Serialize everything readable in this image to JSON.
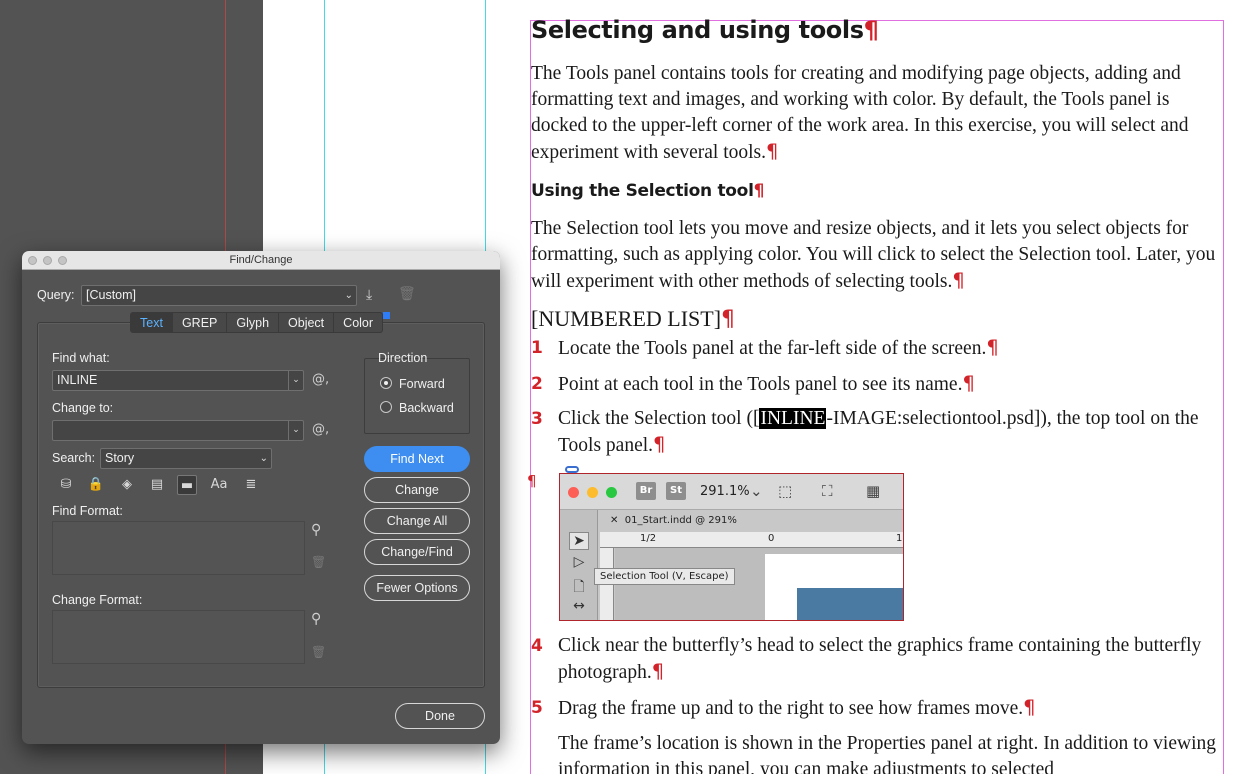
{
  "document": {
    "heading": "Selecting and using tools",
    "intro": "The Tools panel contains tools for creating and modifying page objects, adding and formatting text and images, and working with color. By default, the Tools panel is docked to the upper-left corner of the work area. In this exercise, you will select and experiment with several tools.",
    "subheading": "Using the Selection tool",
    "selection_para": "The Selection tool lets you move and resize objects, and it lets you select objects for formatting, such as applying color. You will click to select the Selection tool. Later, you will experiment with other methods of selecting tools.",
    "list_heading": "[NUMBERED LIST]",
    "pilcrow": "¶",
    "steps": [
      {
        "num": "1",
        "text": "Locate the Tools panel at the far-left side of the screen."
      },
      {
        "num": "2",
        "text": "Point at each tool in the Tools panel to see its name."
      },
      {
        "num": "3",
        "pre": "Click the Selection tool ([",
        "highlight": "INLINE",
        "post": "-IMAGE:selectiontool.psd]), the top tool on the Tools panel."
      },
      {
        "num": "4",
        "text": "Click near the butterfly’s head to select the graphics frame containing the butterfly photograph."
      },
      {
        "num": "5",
        "text": "Drag the frame up and to the right to see how frames move."
      }
    ],
    "after_para": "The frame’s location is shown in the Properties panel at right. In addition to viewing information in this panel, you can make adjustments to selected",
    "inline_image": {
      "br_label": "Br",
      "st_label": "St",
      "zoom": "291.1%",
      "tab": "01_Start.indd @ 291%",
      "ruler_a": "1/2",
      "ruler_b": "0",
      "ruler_c": "1",
      "tooltip": "Selection Tool (V, Escape)"
    }
  },
  "dialog": {
    "title": "Find/Change",
    "query_label": "Query:",
    "query_value": "[Custom]",
    "tabs": [
      "Text",
      "GREP",
      "Glyph",
      "Object",
      "Color"
    ],
    "active_tab": "Text",
    "find_what_label": "Find what:",
    "find_what_value": "INLINE",
    "change_to_label": "Change to:",
    "change_to_value": "",
    "search_label": "Search:",
    "search_value": "Story",
    "direction_label": "Direction",
    "forward_label": "Forward",
    "backward_label": "Backward",
    "direction_selected": "Forward",
    "find_format_label": "Find Format:",
    "change_format_label": "Change Format:",
    "buttons": {
      "find_next": "Find Next",
      "change": "Change",
      "change_all": "Change All",
      "change_find": "Change/Find",
      "fewer_options": "Fewer Options",
      "done": "Done"
    },
    "at_symbol": "@",
    "case_label": "Aa",
    "accent_color": "#3d8ef0"
  }
}
